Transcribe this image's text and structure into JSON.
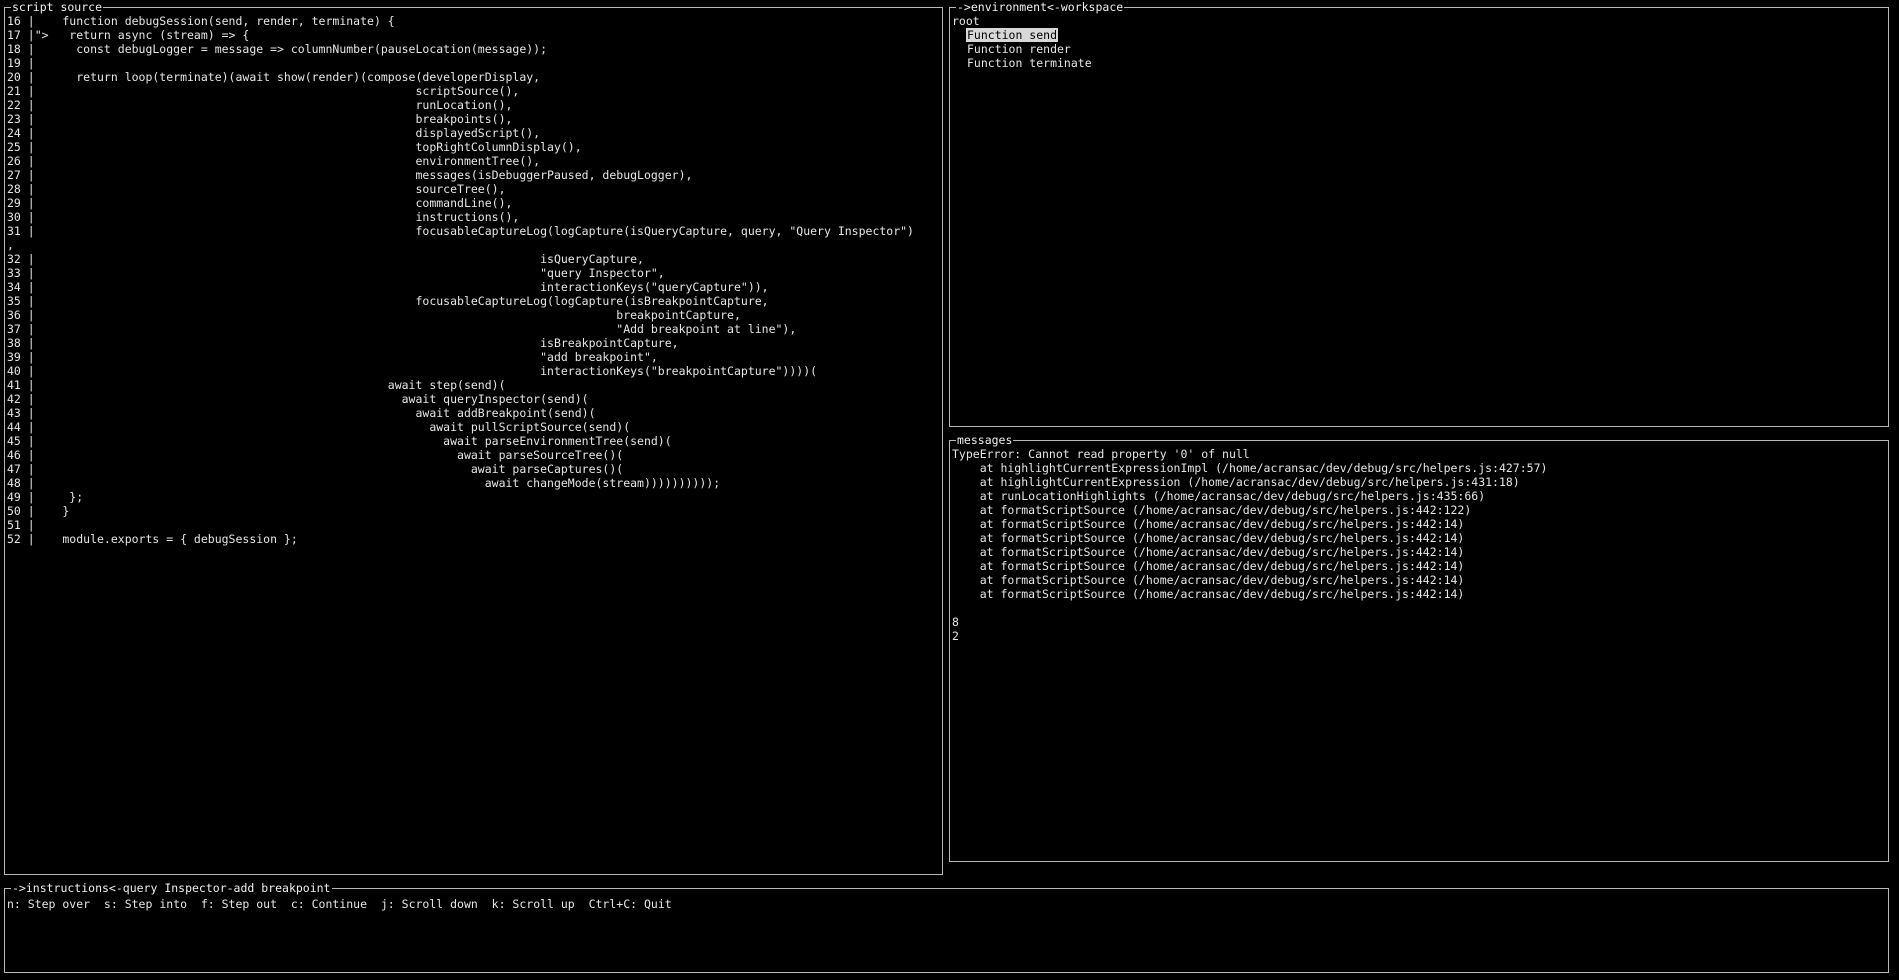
{
  "source": {
    "title": "script source",
    "lines": [
      {
        "num": "16",
        "gutter": "|",
        "code": "  function debugSession(send, render, terminate) {"
      },
      {
        "num": "17",
        "gutter": "|\">",
        "code": "   return async (stream) => {"
      },
      {
        "num": "18",
        "gutter": "|",
        "code": "    const debugLogger = message => columnNumber(pauseLocation(message));"
      },
      {
        "num": "19",
        "gutter": "|",
        "code": ""
      },
      {
        "num": "20",
        "gutter": "|",
        "code": "    return loop(terminate)(await show(render)(compose(developerDisplay,"
      },
      {
        "num": "21",
        "gutter": "|",
        "code": "                                                     scriptSource(),"
      },
      {
        "num": "22",
        "gutter": "|",
        "code": "                                                     runLocation(),"
      },
      {
        "num": "23",
        "gutter": "|",
        "code": "                                                     breakpoints(),"
      },
      {
        "num": "24",
        "gutter": "|",
        "code": "                                                     displayedScript(),"
      },
      {
        "num": "25",
        "gutter": "|",
        "code": "                                                     topRightColumnDisplay(),"
      },
      {
        "num": "26",
        "gutter": "|",
        "code": "                                                     environmentTree(),"
      },
      {
        "num": "27",
        "gutter": "|",
        "code": "                                                     messages(isDebuggerPaused, debugLogger),"
      },
      {
        "num": "28",
        "gutter": "|",
        "code": "                                                     sourceTree(),"
      },
      {
        "num": "29",
        "gutter": "|",
        "code": "                                                     commandLine(),"
      },
      {
        "num": "30",
        "gutter": "|",
        "code": "                                                     instructions(),"
      },
      {
        "num": "31",
        "gutter": "|",
        "code": "                                                     focusableCaptureLog(logCapture(isQueryCapture, query, \"Query Inspector\")"
      },
      {
        "num": ",",
        "gutter": "",
        "code": ""
      },
      {
        "num": "32",
        "gutter": "|",
        "code": "                                                                       isQueryCapture,"
      },
      {
        "num": "33",
        "gutter": "|",
        "code": "                                                                       \"query Inspector\","
      },
      {
        "num": "34",
        "gutter": "|",
        "code": "                                                                       interactionKeys(\"queryCapture\")),"
      },
      {
        "num": "35",
        "gutter": "|",
        "code": "                                                     focusableCaptureLog(logCapture(isBreakpointCapture,"
      },
      {
        "num": "36",
        "gutter": "|",
        "code": "                                                                                  breakpointCapture,"
      },
      {
        "num": "37",
        "gutter": "|",
        "code": "                                                                                  \"Add breakpoint at line\"),"
      },
      {
        "num": "38",
        "gutter": "|",
        "code": "                                                                       isBreakpointCapture,"
      },
      {
        "num": "39",
        "gutter": "|",
        "code": "                                                                       \"add breakpoint\","
      },
      {
        "num": "40",
        "gutter": "|",
        "code": "                                                                       interactionKeys(\"breakpointCapture\"))))("
      },
      {
        "num": "41",
        "gutter": "|",
        "code": "                                                 await step(send)("
      },
      {
        "num": "42",
        "gutter": "|",
        "code": "                                                   await queryInspector(send)("
      },
      {
        "num": "43",
        "gutter": "|",
        "code": "                                                     await addBreakpoint(send)("
      },
      {
        "num": "44",
        "gutter": "|",
        "code": "                                                       await pullScriptSource(send)("
      },
      {
        "num": "45",
        "gutter": "|",
        "code": "                                                         await parseEnvironmentTree(send)("
      },
      {
        "num": "46",
        "gutter": "|",
        "code": "                                                           await parseSourceTree()("
      },
      {
        "num": "47",
        "gutter": "|",
        "code": "                                                             await parseCaptures()("
      },
      {
        "num": "48",
        "gutter": "|",
        "code": "                                                               await changeMode(stream))))))))));"
      },
      {
        "num": "49",
        "gutter": "|",
        "code": "   };"
      },
      {
        "num": "50",
        "gutter": "|",
        "code": "  }"
      },
      {
        "num": "51",
        "gutter": "|",
        "code": ""
      },
      {
        "num": "52",
        "gutter": "|",
        "code": "  module.exports = { debugSession };"
      }
    ]
  },
  "environment": {
    "title": "->environment<-workspace",
    "root_label": "root",
    "items": [
      {
        "label": "Function send",
        "selected": true
      },
      {
        "label": "Function render",
        "selected": false
      },
      {
        "label": "Function terminate",
        "selected": false
      }
    ]
  },
  "messages": {
    "title": "messages",
    "lines": [
      "TypeError: Cannot read property '0' of null",
      "    at highlightCurrentExpressionImpl (/home/acransac/dev/debug/src/helpers.js:427:57)",
      "    at highlightCurrentExpression (/home/acransac/dev/debug/src/helpers.js:431:18)",
      "    at runLocationHighlights (/home/acransac/dev/debug/src/helpers.js:435:66)",
      "    at formatScriptSource (/home/acransac/dev/debug/src/helpers.js:442:122)",
      "    at formatScriptSource (/home/acransac/dev/debug/src/helpers.js:442:14)",
      "    at formatScriptSource (/home/acransac/dev/debug/src/helpers.js:442:14)",
      "    at formatScriptSource (/home/acransac/dev/debug/src/helpers.js:442:14)",
      "    at formatScriptSource (/home/acransac/dev/debug/src/helpers.js:442:14)",
      "    at formatScriptSource (/home/acransac/dev/debug/src/helpers.js:442:14)",
      "    at formatScriptSource (/home/acransac/dev/debug/src/helpers.js:442:14)",
      "",
      "8",
      "2"
    ]
  },
  "instructions": {
    "title": "->instructions<-query Inspector-add breakpoint",
    "text": "n: Step over  s: Step into  f: Step out  c: Continue  j: Scroll down  k: Scroll up  Ctrl+C: Quit"
  }
}
